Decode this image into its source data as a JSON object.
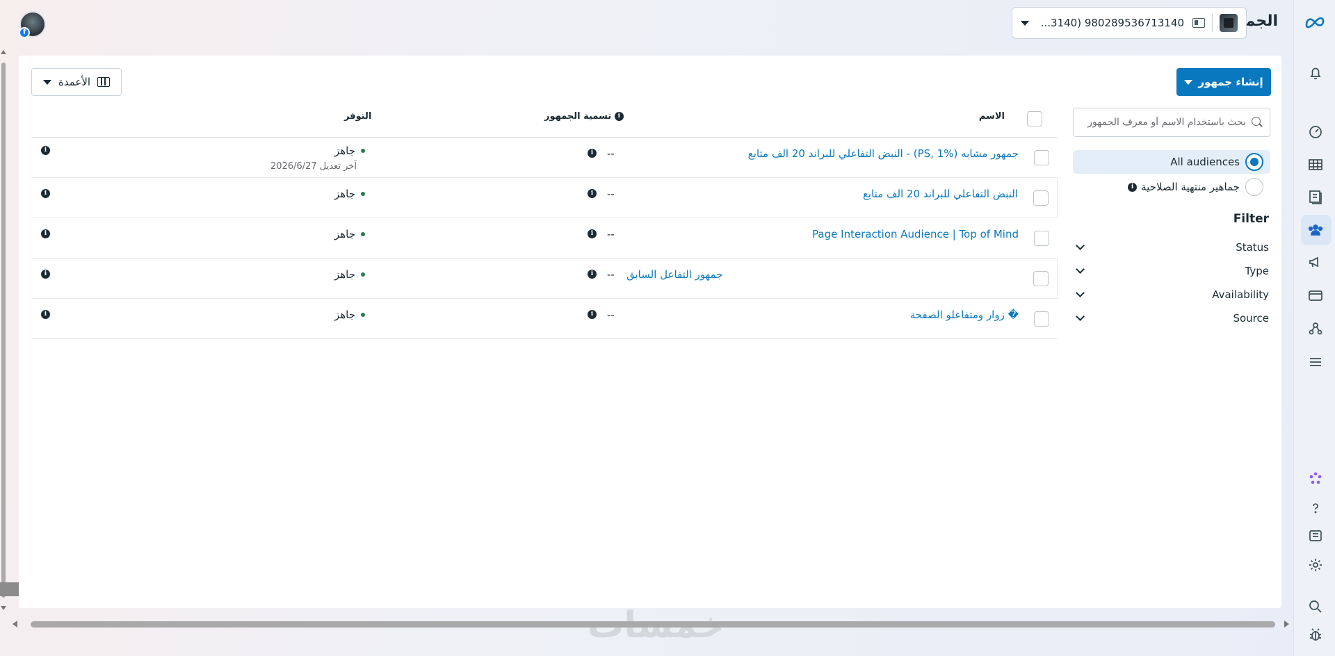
{
  "header": {
    "title": "الجماهير",
    "account_label": "980289536713140 (3140..."
  },
  "toolbar": {
    "create_label": "إنشاء جمهور",
    "columns_label": "الأعمدة"
  },
  "sidebar": {
    "search_placeholder": "بحث باستخدام الاسم أو معرف الجمهور",
    "options": [
      {
        "label": "All audiences",
        "selected": true
      },
      {
        "label": "جماهير منتهية الصلاحية",
        "selected": false
      }
    ],
    "filter_title": "Filter",
    "filters": [
      "Status",
      "Type",
      "Availability",
      "Source"
    ]
  },
  "table": {
    "headers": {
      "name": "الاسم",
      "label": "تسمية الجمهور",
      "availability": "التوفر"
    },
    "rows": [
      {
        "name": "جمهور مشابه (PS, 1%) - النبض التفاعلي للبراند 20 الف متابع",
        "label": "--",
        "label_link": "",
        "status": "جاهز",
        "sub": "آخر تعديل 2026/6/27"
      },
      {
        "name": "النبض التفاعلي للبراند 20 الف متابع",
        "label": "--",
        "label_link": "",
        "status": "جاهز",
        "sub": ""
      },
      {
        "name": "Page Interaction Audience | Top of Mind",
        "label": "--",
        "label_link": "",
        "status": "جاهز",
        "sub": ""
      },
      {
        "name": "",
        "label": "--",
        "label_link": "جمهور التفاعل السابق",
        "status": "جاهز",
        "sub": ""
      },
      {
        "name": "� زوار ومتفاعلو الصفحة",
        "label": "--",
        "label_link": "",
        "status": "جاهز",
        "sub": ""
      }
    ]
  },
  "watermark": "خمسات",
  "colors": {
    "accent": "#0a78be",
    "text": "#1c2b33",
    "ready": "#2d7a4f"
  }
}
